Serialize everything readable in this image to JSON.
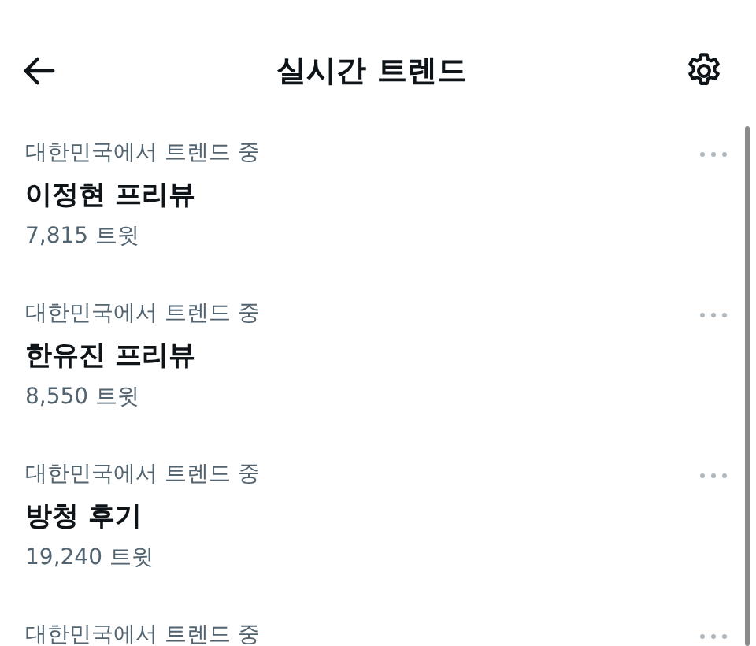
{
  "header": {
    "title": "실시간 트렌드"
  },
  "trends": [
    {
      "context": "대한민국에서 트렌드 중",
      "name": "이정현 프리뷰",
      "count": "7,815 트윗"
    },
    {
      "context": "대한민국에서 트렌드 중",
      "name": "한유진 프리뷰",
      "count": "8,550 트윗"
    },
    {
      "context": "대한민국에서 트렌드 중",
      "name": "방청 후기",
      "count": "19,240 트윗"
    },
    {
      "context": "대한민국에서 트렌드 중"
    }
  ]
}
